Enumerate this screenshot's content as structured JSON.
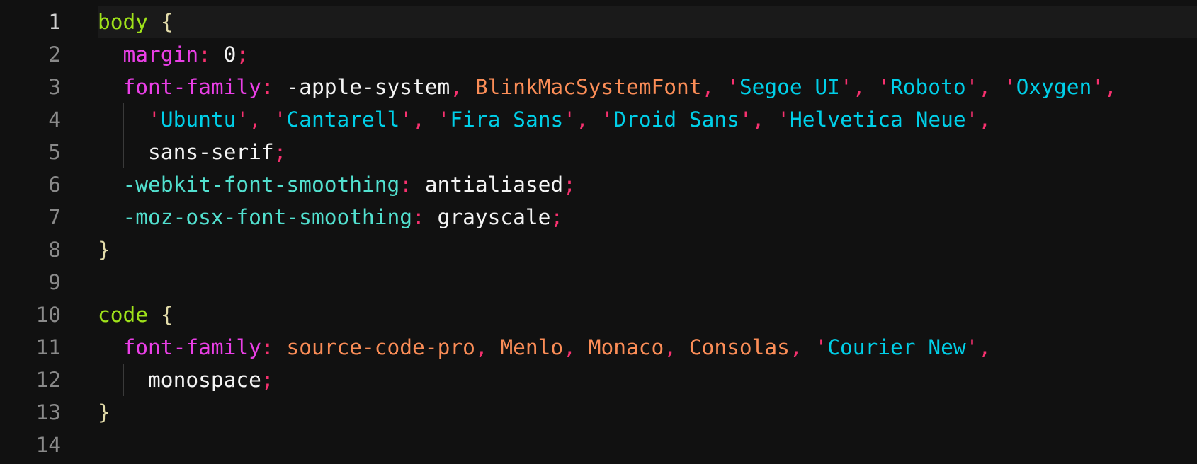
{
  "editor": {
    "language": "css",
    "active_line": 1,
    "colors": {
      "background": "#111111",
      "selector": "#9fe21a",
      "brace": "#e3dcaa",
      "property": "#ea3fe6",
      "vendor_property": "#52e0cf",
      "punctuation": "#f7316f",
      "value": "#f4f4f4",
      "font_name": "#fb8d57",
      "string": "#00cfe8",
      "line_number": "#8a8a8a"
    },
    "lines": [
      {
        "number": "1",
        "indent": 0,
        "tokens": [
          [
            "selector",
            "body"
          ],
          [
            "value",
            " "
          ],
          [
            "brace",
            "{"
          ]
        ]
      },
      {
        "number": "2",
        "indent": 1,
        "tokens": [
          [
            "prop",
            "margin"
          ],
          [
            "punct",
            ":"
          ],
          [
            "value",
            " 0"
          ],
          [
            "punct",
            ";"
          ]
        ]
      },
      {
        "number": "3",
        "indent": 1,
        "tokens": [
          [
            "prop",
            "font-family"
          ],
          [
            "punct",
            ":"
          ],
          [
            "value",
            " -apple-system"
          ],
          [
            "punct",
            ", "
          ],
          [
            "font",
            "BlinkMacSystemFont"
          ],
          [
            "punct",
            ", "
          ],
          [
            "quote",
            "'"
          ],
          [
            "string",
            "Segoe UI"
          ],
          [
            "quote",
            "'"
          ],
          [
            "punct",
            ", "
          ],
          [
            "quote",
            "'"
          ],
          [
            "string",
            "Roboto"
          ],
          [
            "quote",
            "'"
          ],
          [
            "punct",
            ", "
          ],
          [
            "quote",
            "'"
          ],
          [
            "string",
            "Oxygen"
          ],
          [
            "quote",
            "'"
          ],
          [
            "punct",
            ","
          ]
        ]
      },
      {
        "number": "4",
        "indent": 2,
        "tokens": [
          [
            "quote",
            "'"
          ],
          [
            "string",
            "Ubuntu"
          ],
          [
            "quote",
            "'"
          ],
          [
            "punct",
            ", "
          ],
          [
            "quote",
            "'"
          ],
          [
            "string",
            "Cantarell"
          ],
          [
            "quote",
            "'"
          ],
          [
            "punct",
            ", "
          ],
          [
            "quote",
            "'"
          ],
          [
            "string",
            "Fira Sans"
          ],
          [
            "quote",
            "'"
          ],
          [
            "punct",
            ", "
          ],
          [
            "quote",
            "'"
          ],
          [
            "string",
            "Droid Sans"
          ],
          [
            "quote",
            "'"
          ],
          [
            "punct",
            ", "
          ],
          [
            "quote",
            "'"
          ],
          [
            "string",
            "Helvetica Neue"
          ],
          [
            "quote",
            "'"
          ],
          [
            "punct",
            ","
          ]
        ]
      },
      {
        "number": "5",
        "indent": 2,
        "tokens": [
          [
            "value",
            "sans-serif"
          ],
          [
            "punct",
            ";"
          ]
        ]
      },
      {
        "number": "6",
        "indent": 1,
        "tokens": [
          [
            "vendor",
            "-webkit-font-smoothing"
          ],
          [
            "punct",
            ":"
          ],
          [
            "value",
            " antialiased"
          ],
          [
            "punct",
            ";"
          ]
        ]
      },
      {
        "number": "7",
        "indent": 1,
        "tokens": [
          [
            "vendor",
            "-moz-osx-font-smoothing"
          ],
          [
            "punct",
            ":"
          ],
          [
            "value",
            " grayscale"
          ],
          [
            "punct",
            ";"
          ]
        ]
      },
      {
        "number": "8",
        "indent": 0,
        "tokens": [
          [
            "brace",
            "}"
          ]
        ]
      },
      {
        "number": "9",
        "indent": 0,
        "tokens": []
      },
      {
        "number": "10",
        "indent": 0,
        "tokens": [
          [
            "selector",
            "code"
          ],
          [
            "value",
            " "
          ],
          [
            "brace",
            "{"
          ]
        ]
      },
      {
        "number": "11",
        "indent": 1,
        "tokens": [
          [
            "prop",
            "font-family"
          ],
          [
            "punct",
            ":"
          ],
          [
            "value",
            " "
          ],
          [
            "font",
            "source-code-pro"
          ],
          [
            "punct",
            ", "
          ],
          [
            "font",
            "Menlo"
          ],
          [
            "punct",
            ", "
          ],
          [
            "font",
            "Monaco"
          ],
          [
            "punct",
            ", "
          ],
          [
            "font",
            "Consolas"
          ],
          [
            "punct",
            ", "
          ],
          [
            "quote",
            "'"
          ],
          [
            "string",
            "Courier New"
          ],
          [
            "quote",
            "'"
          ],
          [
            "punct",
            ","
          ]
        ]
      },
      {
        "number": "12",
        "indent": 2,
        "tokens": [
          [
            "value",
            "monospace"
          ],
          [
            "punct",
            ";"
          ]
        ]
      },
      {
        "number": "13",
        "indent": 0,
        "tokens": [
          [
            "brace",
            "}"
          ]
        ]
      },
      {
        "number": "14",
        "indent": 0,
        "tokens": []
      }
    ]
  }
}
